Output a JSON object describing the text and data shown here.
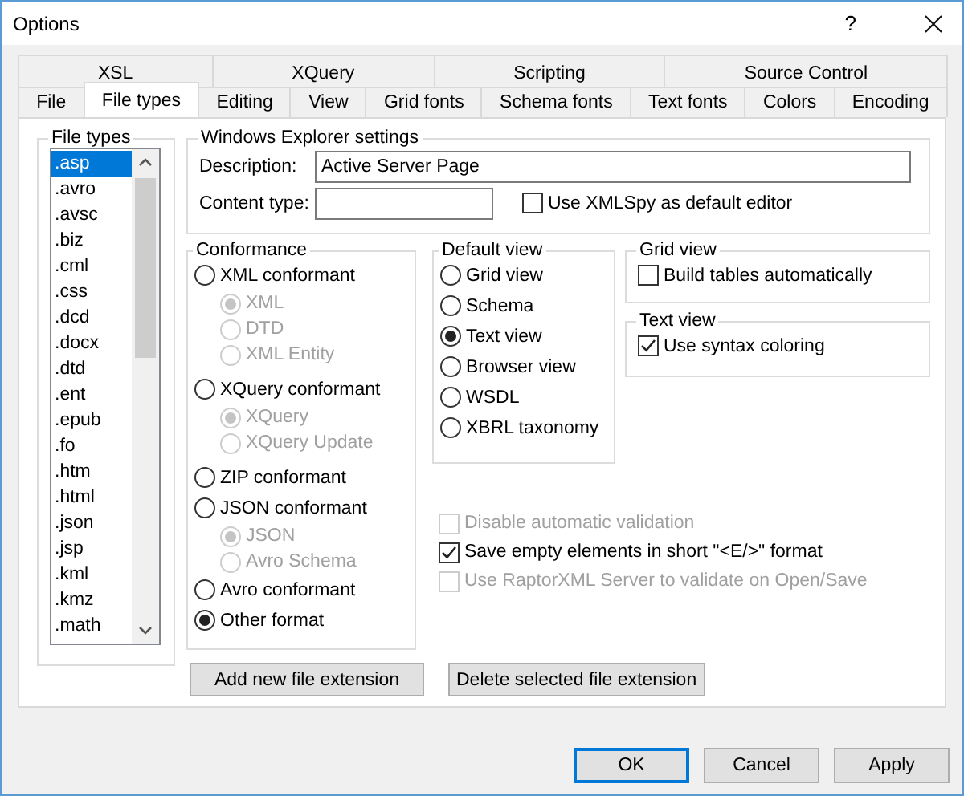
{
  "window": {
    "title": "Options",
    "help": "?"
  },
  "tab_rows": [
    {
      "tabs": [
        {
          "label": "XSL",
          "selected": false
        },
        {
          "label": "XQuery",
          "selected": false
        },
        {
          "label": "Scripting",
          "selected": false
        },
        {
          "label": "Source Control",
          "selected": false
        }
      ]
    },
    {
      "tabs": [
        {
          "label": "File",
          "selected": false
        },
        {
          "label": "File types",
          "selected": true
        },
        {
          "label": "Editing",
          "selected": false
        },
        {
          "label": "View",
          "selected": false
        },
        {
          "label": "Grid fonts",
          "selected": false
        },
        {
          "label": "Schema fonts",
          "selected": false
        },
        {
          "label": "Text fonts",
          "selected": false
        },
        {
          "label": "Colors",
          "selected": false
        },
        {
          "label": "Encoding",
          "selected": false
        }
      ]
    }
  ],
  "file_types": {
    "title": "File types",
    "items": [
      {
        "label": ".asp",
        "selected": true
      },
      {
        "label": ".avro",
        "selected": false
      },
      {
        "label": ".avsc",
        "selected": false
      },
      {
        "label": ".biz",
        "selected": false
      },
      {
        "label": ".cml",
        "selected": false
      },
      {
        "label": ".css",
        "selected": false
      },
      {
        "label": ".dcd",
        "selected": false
      },
      {
        "label": ".docx",
        "selected": false
      },
      {
        "label": ".dtd",
        "selected": false
      },
      {
        "label": ".ent",
        "selected": false
      },
      {
        "label": ".epub",
        "selected": false
      },
      {
        "label": ".fo",
        "selected": false
      },
      {
        "label": ".htm",
        "selected": false
      },
      {
        "label": ".html",
        "selected": false
      },
      {
        "label": ".json",
        "selected": false
      },
      {
        "label": ".jsp",
        "selected": false
      },
      {
        "label": ".kml",
        "selected": false
      },
      {
        "label": ".kmz",
        "selected": false
      },
      {
        "label": ".math",
        "selected": false
      }
    ]
  },
  "explorer": {
    "title": "Windows Explorer settings",
    "description_label": "Description:",
    "description_value": "Active Server Page",
    "content_type_label": "Content type:",
    "default_editor": {
      "label": "Use XMLSpy as default editor",
      "checked": false
    }
  },
  "conformance": {
    "title": "Conformance",
    "options": [
      {
        "label": "XML conformant",
        "selected": false,
        "disabled": false,
        "children": [
          {
            "label": "XML",
            "selected": true,
            "disabled": true
          },
          {
            "label": "DTD",
            "selected": false,
            "disabled": true
          },
          {
            "label": "XML Entity",
            "selected": false,
            "disabled": true
          }
        ]
      },
      {
        "label": "XQuery conformant",
        "selected": false,
        "disabled": false,
        "children": [
          {
            "label": "XQuery",
            "selected": true,
            "disabled": true
          },
          {
            "label": "XQuery Update",
            "selected": false,
            "disabled": true
          }
        ]
      },
      {
        "label": "ZIP conformant",
        "selected": false,
        "disabled": false
      },
      {
        "label": "JSON conformant",
        "selected": false,
        "disabled": false,
        "children": [
          {
            "label": "JSON",
            "selected": true,
            "disabled": true
          },
          {
            "label": "Avro Schema",
            "selected": false,
            "disabled": true
          }
        ]
      },
      {
        "label": "Avro conformant",
        "selected": false,
        "disabled": false
      },
      {
        "label": "Other format",
        "selected": true,
        "disabled": false
      }
    ]
  },
  "default_view": {
    "title": "Default view",
    "options": [
      {
        "label": "Grid view",
        "selected": false
      },
      {
        "label": "Schema",
        "selected": false
      },
      {
        "label": "Text view",
        "selected": true
      },
      {
        "label": "Browser view",
        "selected": false
      },
      {
        "label": "WSDL",
        "selected": false
      },
      {
        "label": "XBRL taxonomy",
        "selected": false
      }
    ]
  },
  "grid_view": {
    "title": "Grid view",
    "checkbox": {
      "label": "Build tables automatically",
      "checked": false
    }
  },
  "text_view": {
    "title": "Text view",
    "checkbox": {
      "label": "Use syntax coloring",
      "checked": true
    }
  },
  "options": [
    {
      "label": "Disable automatic validation",
      "checked": false,
      "disabled": true
    },
    {
      "label": "Save empty elements in short \"<E/>\" format",
      "checked": true,
      "disabled": false
    },
    {
      "label": "Use RaptorXML Server to validate on Open/Save",
      "checked": false,
      "disabled": true
    }
  ],
  "actions": [
    "Add new file extension",
    "Delete selected file extension"
  ],
  "dialog_buttons": [
    {
      "label": "OK",
      "default": true
    },
    {
      "label": "Cancel",
      "default": false
    },
    {
      "label": "Apply",
      "default": false
    }
  ]
}
